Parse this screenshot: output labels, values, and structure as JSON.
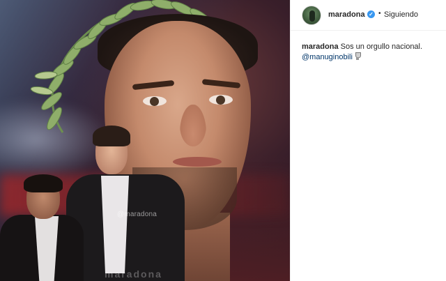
{
  "post": {
    "image_alt": "",
    "watermark_center": "@maradona",
    "watermark_bottom": "maradona"
  },
  "header": {
    "username": "maradona",
    "verified": true,
    "separator": "•",
    "follow_status": "Siguiendo"
  },
  "caption": {
    "username": "maradona",
    "text": "Sos un orgullo nacional.",
    "mention": "@manuginobili",
    "emoji_icon": "trophy-icon"
  },
  "colors": {
    "verified_badge": "#3897f0",
    "mention_link": "#003569",
    "panel_border": "#efefef"
  }
}
